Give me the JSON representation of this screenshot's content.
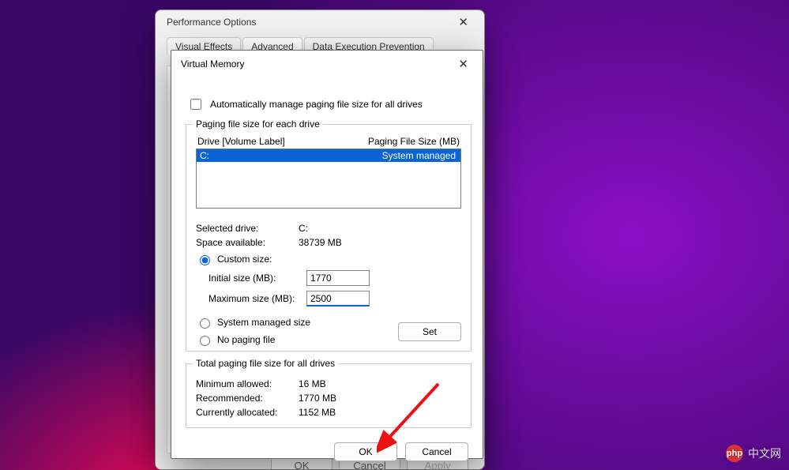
{
  "parent": {
    "title": "Performance Options",
    "tabs": [
      "Visual Effects",
      "Advanced",
      "Data Execution Prevention"
    ],
    "active_tab": "Advanced",
    "buttons": {
      "ok": "OK",
      "cancel": "Cancel",
      "apply": "Apply"
    }
  },
  "dialog": {
    "title": "Virtual Memory",
    "auto_manage": {
      "checked": false,
      "label": "Automatically manage paging file size for all drives"
    },
    "drive_group": {
      "legend": "Paging file size for each drive",
      "columns": {
        "drive": "Drive  [Volume Label]",
        "size": "Paging File Size (MB)"
      },
      "rows": [
        {
          "drive": "C:",
          "size": "System managed",
          "selected": true
        }
      ],
      "selected_drive": {
        "label": "Selected drive:",
        "value": "C:"
      },
      "space_available": {
        "label": "Space available:",
        "value": "38739 MB"
      },
      "options": {
        "custom_size": {
          "label": "Custom size:",
          "checked": true
        },
        "initial": {
          "label": "Initial size (MB):",
          "value": "1770"
        },
        "maximum": {
          "label": "Maximum size (MB):",
          "value": "2500"
        },
        "system_managed": {
          "label": "System managed size",
          "checked": false
        },
        "no_paging": {
          "label": "No paging file",
          "checked": false
        },
        "set": "Set"
      }
    },
    "totals": {
      "legend": "Total paging file size for all drives",
      "minimum": {
        "label": "Minimum allowed:",
        "value": "16 MB"
      },
      "recommended": {
        "label": "Recommended:",
        "value": "1770 MB"
      },
      "allocated": {
        "label": "Currently allocated:",
        "value": "1152 MB"
      }
    },
    "buttons": {
      "ok": "OK",
      "cancel": "Cancel"
    }
  },
  "watermark": {
    "logo": "php",
    "text": "中文网"
  }
}
